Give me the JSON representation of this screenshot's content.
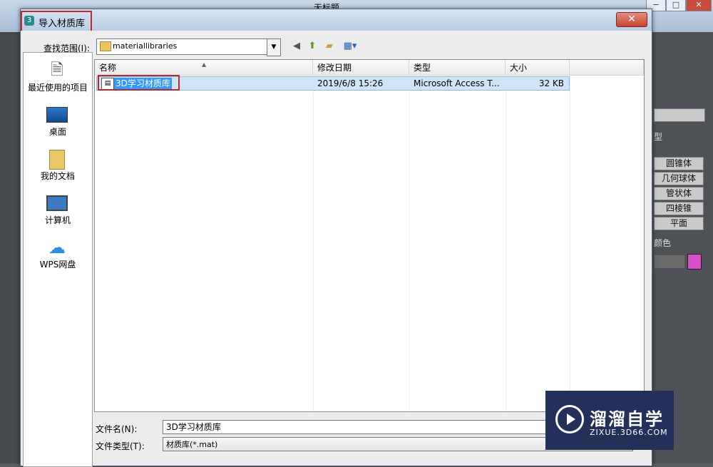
{
  "background": {
    "title": "无标题",
    "right_panel": {
      "label_top": "型",
      "buttons": [
        "圆锥体",
        "几何球体",
        "管状体",
        "四棱锥",
        "平面"
      ],
      "label_color": "颜色",
      "swatch_color": "#d94fc7"
    }
  },
  "dialog": {
    "title": "导入材质库",
    "close_label": "✕",
    "look_in_label": "查找范围(I):",
    "look_in_value": "materiallibraries",
    "toolbar_icons": [
      "back-icon",
      "up-folder-icon",
      "new-folder-icon",
      "view-menu-icon"
    ],
    "places": [
      {
        "label": "最近使用的项目",
        "icon": "recent-items-icon"
      },
      {
        "label": "桌面",
        "icon": "desktop-icon"
      },
      {
        "label": "我的文档",
        "icon": "my-documents-icon"
      },
      {
        "label": "计算机",
        "icon": "computer-icon"
      },
      {
        "label": "WPS网盘",
        "icon": "cloud-icon"
      }
    ],
    "columns": [
      "名称",
      "修改日期",
      "类型",
      "大小"
    ],
    "files": [
      {
        "name": "3D学习材质库",
        "modified": "2019/6/8 15:26",
        "type": "Microsoft Access T...",
        "size": "32 KB",
        "selected": true
      }
    ],
    "filename_label": "文件名(N):",
    "filename_value": "3D学习材质库",
    "filetype_label": "文件类型(T):",
    "filetype_value": "材质库(*.mat)"
  },
  "watermark": {
    "title": "溜溜自学",
    "subtitle": "ZIXUE.3D66.COM"
  }
}
